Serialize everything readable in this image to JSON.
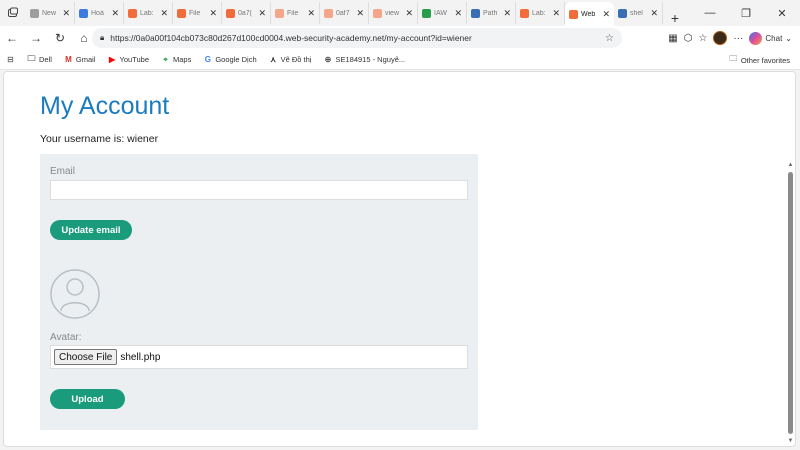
{
  "browser": {
    "tabs": [
      {
        "label": "New",
        "icon": "page-icon",
        "color": "#9e9e9e"
      },
      {
        "label": "Hoà",
        "icon": "sparkle-icon",
        "color": "#3d7be0"
      },
      {
        "label": "Lab:",
        "icon": "portswigger-icon",
        "color": "#f26b3a"
      },
      {
        "label": "File",
        "icon": "portswigger-icon",
        "color": "#f26b3a"
      },
      {
        "label": "0a7(",
        "icon": "portswigger-icon",
        "color": "#f26b3a"
      },
      {
        "label": "File",
        "icon": "portswigger-icon",
        "color": "#f5a58a"
      },
      {
        "label": "0af7",
        "icon": "portswigger-icon",
        "color": "#f5a58a"
      },
      {
        "label": "view",
        "icon": "portswigger-icon",
        "color": "#f5a58a"
      },
      {
        "label": "IAW",
        "icon": "drive-icon",
        "color": "#2a9d4a"
      },
      {
        "label": "Path",
        "icon": "github-icon",
        "color": "#3b6fb5"
      },
      {
        "label": "Lab:",
        "icon": "portswigger-icon",
        "color": "#f26b3a"
      },
      {
        "label": "Web",
        "icon": "portswigger-icon",
        "color": "#f26b3a",
        "active": true
      },
      {
        "label": "shel",
        "icon": "search-icon",
        "color": "#3b6fb5"
      }
    ],
    "url": "https://0a0a00f104cb073c80d267d100cd0004.web-security-academy.net/my-account?id=wiener",
    "chat_label": "Chat",
    "bookmarks": [
      {
        "label": "Dell",
        "icon": "folder-icon"
      },
      {
        "label": "Gmail",
        "icon": "gmail-icon"
      },
      {
        "label": "YouTube",
        "icon": "youtube-icon"
      },
      {
        "label": "Maps",
        "icon": "maps-icon"
      },
      {
        "label": "Google Dịch",
        "icon": "translate-icon"
      },
      {
        "label": "Vẽ Đồ thị",
        "icon": "graph-icon"
      },
      {
        "label": "SE184915 - Nguyê...",
        "icon": "globe-icon"
      }
    ],
    "other_favorites": "Other favorites"
  },
  "page": {
    "title": "My Account",
    "username_text": "Your username is: wiener",
    "email_label": "Email",
    "email_value": "",
    "update_email_label": "Update email",
    "avatar_label": "Avatar:",
    "choose_file_label": "Choose File",
    "file_name": "shell.php",
    "upload_label": "Upload"
  },
  "colors": {
    "title": "#1a7bbf",
    "button": "#1a9b7c",
    "panel": "#ebeff2"
  }
}
